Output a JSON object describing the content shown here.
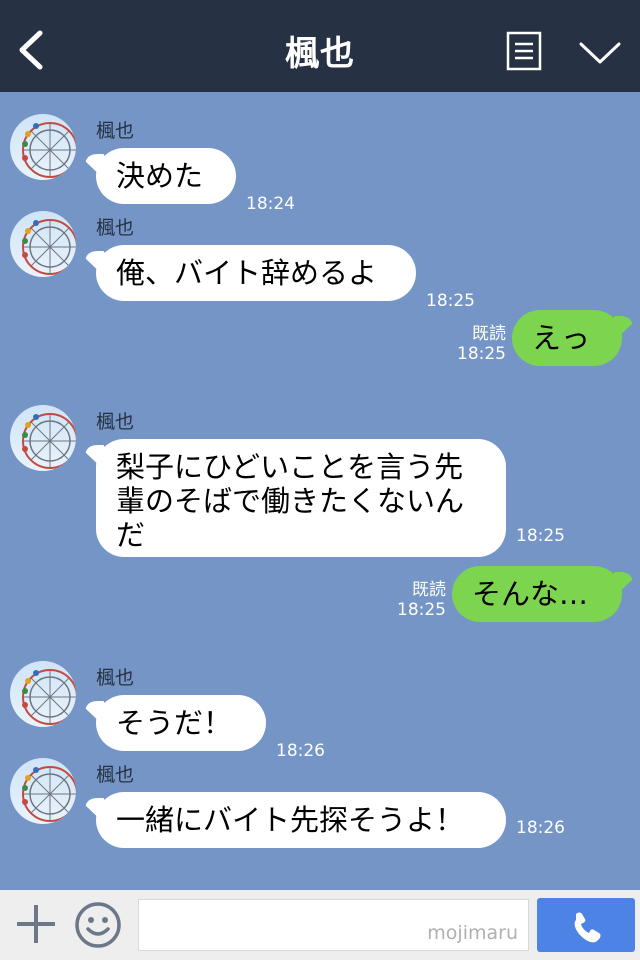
{
  "header": {
    "title": "楓也",
    "icons": {
      "back": "chevron-left-icon",
      "notes": "notes-icon",
      "menu": "chevron-down-icon"
    },
    "colors": {
      "bar": "#263143",
      "text": "#ffffff"
    }
  },
  "chat": {
    "background": "#7495c6",
    "messages": [
      {
        "sender": "楓也",
        "text": "決めた",
        "time": "18:24"
      },
      {
        "sender": "楓也",
        "text": "俺、バイト辞めるよ",
        "time": "18:25"
      },
      {
        "self": true,
        "text": "えっ",
        "read": "既読",
        "time": "18:25"
      },
      {
        "sender": "楓也",
        "text": "梨子にひどいことを言う先輩のそばで働きたくないんだ",
        "time": "18:25"
      },
      {
        "self": true,
        "text": "そんな…",
        "read": "既読",
        "time": "18:25"
      },
      {
        "sender": "楓也",
        "text": "そうだ！",
        "time": "18:26"
      },
      {
        "sender": "楓也",
        "text": "一緒にバイト先探そうよ！",
        "time": "18:26"
      }
    ]
  },
  "input": {
    "placeholder": "",
    "value": "",
    "watermark": "mojimaru",
    "icons": {
      "plus": "plus-icon",
      "emoji": "smiley-icon",
      "send": "phone-icon"
    },
    "send_color": "#4c83e4"
  },
  "bubble_colors": {
    "incoming": "#ffffff",
    "outgoing": "#7cd44f"
  }
}
